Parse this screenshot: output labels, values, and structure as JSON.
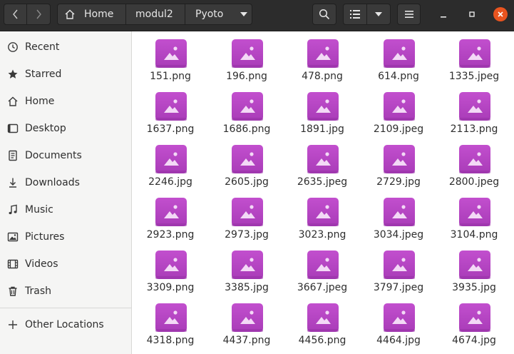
{
  "header": {
    "breadcrumbs": [
      "Home",
      "modul2",
      "Pyoto"
    ]
  },
  "sidebar": {
    "items": [
      {
        "label": "Recent",
        "icon": "clock-icon"
      },
      {
        "label": "Starred",
        "icon": "star-icon"
      },
      {
        "label": "Home",
        "icon": "home-icon"
      },
      {
        "label": "Desktop",
        "icon": "desktop-icon"
      },
      {
        "label": "Documents",
        "icon": "documents-icon"
      },
      {
        "label": "Downloads",
        "icon": "download-icon"
      },
      {
        "label": "Music",
        "icon": "music-icon"
      },
      {
        "label": "Pictures",
        "icon": "pictures-icon"
      },
      {
        "label": "Videos",
        "icon": "videos-icon"
      },
      {
        "label": "Trash",
        "icon": "trash-icon"
      }
    ],
    "other_locations": "Other Locations"
  },
  "files": [
    "151.png",
    "196.png",
    "478.png",
    "614.png",
    "1335.jpeg",
    "1637.png",
    "1686.png",
    "1891.jpg",
    "2109.jpeg",
    "2113.png",
    "2246.jpg",
    "2605.jpg",
    "2635.jpeg",
    "2729.jpg",
    "2800.jpeg",
    "2923.png",
    "2973.jpg",
    "3023.png",
    "3034.jpeg",
    "3104.png",
    "3309.png",
    "3385.jpg",
    "3667.jpeg",
    "3797.jpeg",
    "3935.jpg",
    "4318.png",
    "4437.png",
    "4456.png",
    "4464.jpg",
    "4674.jpg"
  ],
  "colors": {
    "headerbar": "#2c2c2c",
    "close_button": "#e9541f",
    "image_icon": "#b94bc5"
  }
}
